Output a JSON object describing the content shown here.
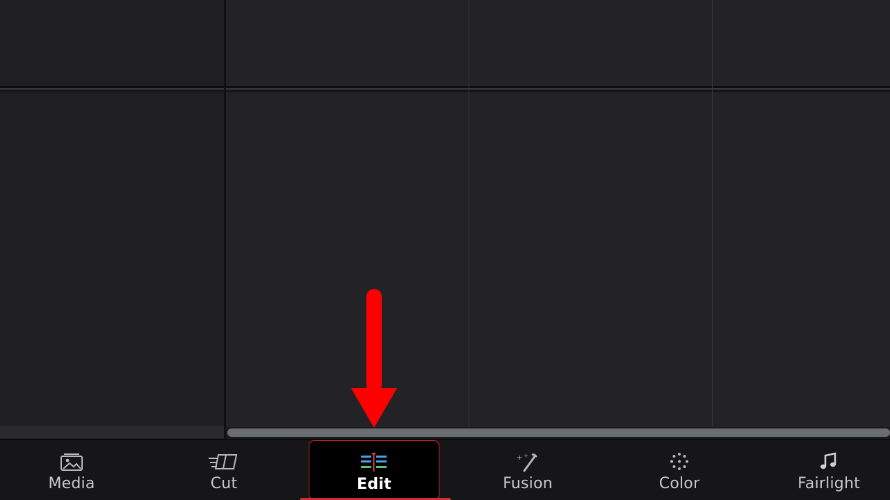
{
  "nav": {
    "items": [
      {
        "label": "Media",
        "icon": "media-icon",
        "active": false
      },
      {
        "label": "Cut",
        "icon": "cut-icon",
        "active": false
      },
      {
        "label": "Edit",
        "icon": "edit-icon",
        "active": true
      },
      {
        "label": "Fusion",
        "icon": "fusion-icon",
        "active": false
      },
      {
        "label": "Color",
        "icon": "color-icon",
        "active": false
      },
      {
        "label": "Fairlight",
        "icon": "fairlight-icon",
        "active": false
      }
    ]
  },
  "annotation": {
    "type": "arrow",
    "color": "#ff0000",
    "points_to": "Edit"
  },
  "colors": {
    "background": "#1c1c1f",
    "panel": "#232327",
    "nav_background": "#161618",
    "active_border": "#e0202a",
    "scrollbar": "#6a6e73"
  }
}
